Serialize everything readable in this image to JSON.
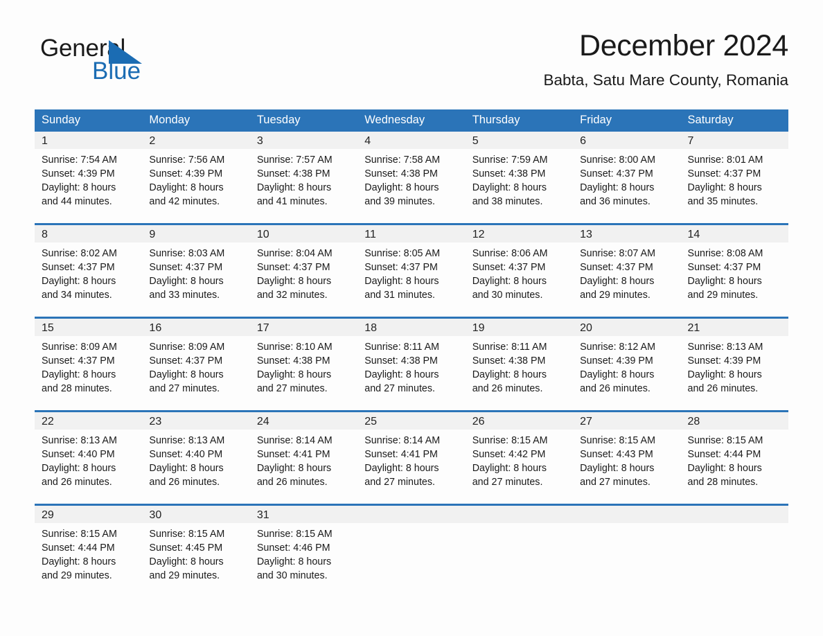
{
  "brand": {
    "name_part1": "General",
    "name_part2": "Blue",
    "accent_color": "#1b6cb3"
  },
  "header": {
    "title": "December 2024",
    "subtitle": "Babta, Satu Mare County, Romania"
  },
  "table": {
    "header_bg": "#2b74b8",
    "daynum_bg": "#f1f1f1",
    "weekdays": [
      "Sunday",
      "Monday",
      "Tuesday",
      "Wednesday",
      "Thursday",
      "Friday",
      "Saturday"
    ]
  },
  "weeks": [
    [
      {
        "day": "1",
        "sunrise": "Sunrise: 7:54 AM",
        "sunset": "Sunset: 4:39 PM",
        "daylight1": "Daylight: 8 hours",
        "daylight2": "and 44 minutes."
      },
      {
        "day": "2",
        "sunrise": "Sunrise: 7:56 AM",
        "sunset": "Sunset: 4:39 PM",
        "daylight1": "Daylight: 8 hours",
        "daylight2": "and 42 minutes."
      },
      {
        "day": "3",
        "sunrise": "Sunrise: 7:57 AM",
        "sunset": "Sunset: 4:38 PM",
        "daylight1": "Daylight: 8 hours",
        "daylight2": "and 41 minutes."
      },
      {
        "day": "4",
        "sunrise": "Sunrise: 7:58 AM",
        "sunset": "Sunset: 4:38 PM",
        "daylight1": "Daylight: 8 hours",
        "daylight2": "and 39 minutes."
      },
      {
        "day": "5",
        "sunrise": "Sunrise: 7:59 AM",
        "sunset": "Sunset: 4:38 PM",
        "daylight1": "Daylight: 8 hours",
        "daylight2": "and 38 minutes."
      },
      {
        "day": "6",
        "sunrise": "Sunrise: 8:00 AM",
        "sunset": "Sunset: 4:37 PM",
        "daylight1": "Daylight: 8 hours",
        "daylight2": "and 36 minutes."
      },
      {
        "day": "7",
        "sunrise": "Sunrise: 8:01 AM",
        "sunset": "Sunset: 4:37 PM",
        "daylight1": "Daylight: 8 hours",
        "daylight2": "and 35 minutes."
      }
    ],
    [
      {
        "day": "8",
        "sunrise": "Sunrise: 8:02 AM",
        "sunset": "Sunset: 4:37 PM",
        "daylight1": "Daylight: 8 hours",
        "daylight2": "and 34 minutes."
      },
      {
        "day": "9",
        "sunrise": "Sunrise: 8:03 AM",
        "sunset": "Sunset: 4:37 PM",
        "daylight1": "Daylight: 8 hours",
        "daylight2": "and 33 minutes."
      },
      {
        "day": "10",
        "sunrise": "Sunrise: 8:04 AM",
        "sunset": "Sunset: 4:37 PM",
        "daylight1": "Daylight: 8 hours",
        "daylight2": "and 32 minutes."
      },
      {
        "day": "11",
        "sunrise": "Sunrise: 8:05 AM",
        "sunset": "Sunset: 4:37 PM",
        "daylight1": "Daylight: 8 hours",
        "daylight2": "and 31 minutes."
      },
      {
        "day": "12",
        "sunrise": "Sunrise: 8:06 AM",
        "sunset": "Sunset: 4:37 PM",
        "daylight1": "Daylight: 8 hours",
        "daylight2": "and 30 minutes."
      },
      {
        "day": "13",
        "sunrise": "Sunrise: 8:07 AM",
        "sunset": "Sunset: 4:37 PM",
        "daylight1": "Daylight: 8 hours",
        "daylight2": "and 29 minutes."
      },
      {
        "day": "14",
        "sunrise": "Sunrise: 8:08 AM",
        "sunset": "Sunset: 4:37 PM",
        "daylight1": "Daylight: 8 hours",
        "daylight2": "and 29 minutes."
      }
    ],
    [
      {
        "day": "15",
        "sunrise": "Sunrise: 8:09 AM",
        "sunset": "Sunset: 4:37 PM",
        "daylight1": "Daylight: 8 hours",
        "daylight2": "and 28 minutes."
      },
      {
        "day": "16",
        "sunrise": "Sunrise: 8:09 AM",
        "sunset": "Sunset: 4:37 PM",
        "daylight1": "Daylight: 8 hours",
        "daylight2": "and 27 minutes."
      },
      {
        "day": "17",
        "sunrise": "Sunrise: 8:10 AM",
        "sunset": "Sunset: 4:38 PM",
        "daylight1": "Daylight: 8 hours",
        "daylight2": "and 27 minutes."
      },
      {
        "day": "18",
        "sunrise": "Sunrise: 8:11 AM",
        "sunset": "Sunset: 4:38 PM",
        "daylight1": "Daylight: 8 hours",
        "daylight2": "and 27 minutes."
      },
      {
        "day": "19",
        "sunrise": "Sunrise: 8:11 AM",
        "sunset": "Sunset: 4:38 PM",
        "daylight1": "Daylight: 8 hours",
        "daylight2": "and 26 minutes."
      },
      {
        "day": "20",
        "sunrise": "Sunrise: 8:12 AM",
        "sunset": "Sunset: 4:39 PM",
        "daylight1": "Daylight: 8 hours",
        "daylight2": "and 26 minutes."
      },
      {
        "day": "21",
        "sunrise": "Sunrise: 8:13 AM",
        "sunset": "Sunset: 4:39 PM",
        "daylight1": "Daylight: 8 hours",
        "daylight2": "and 26 minutes."
      }
    ],
    [
      {
        "day": "22",
        "sunrise": "Sunrise: 8:13 AM",
        "sunset": "Sunset: 4:40 PM",
        "daylight1": "Daylight: 8 hours",
        "daylight2": "and 26 minutes."
      },
      {
        "day": "23",
        "sunrise": "Sunrise: 8:13 AM",
        "sunset": "Sunset: 4:40 PM",
        "daylight1": "Daylight: 8 hours",
        "daylight2": "and 26 minutes."
      },
      {
        "day": "24",
        "sunrise": "Sunrise: 8:14 AM",
        "sunset": "Sunset: 4:41 PM",
        "daylight1": "Daylight: 8 hours",
        "daylight2": "and 26 minutes."
      },
      {
        "day": "25",
        "sunrise": "Sunrise: 8:14 AM",
        "sunset": "Sunset: 4:41 PM",
        "daylight1": "Daylight: 8 hours",
        "daylight2": "and 27 minutes."
      },
      {
        "day": "26",
        "sunrise": "Sunrise: 8:15 AM",
        "sunset": "Sunset: 4:42 PM",
        "daylight1": "Daylight: 8 hours",
        "daylight2": "and 27 minutes."
      },
      {
        "day": "27",
        "sunrise": "Sunrise: 8:15 AM",
        "sunset": "Sunset: 4:43 PM",
        "daylight1": "Daylight: 8 hours",
        "daylight2": "and 27 minutes."
      },
      {
        "day": "28",
        "sunrise": "Sunrise: 8:15 AM",
        "sunset": "Sunset: 4:44 PM",
        "daylight1": "Daylight: 8 hours",
        "daylight2": "and 28 minutes."
      }
    ],
    [
      {
        "day": "29",
        "sunrise": "Sunrise: 8:15 AM",
        "sunset": "Sunset: 4:44 PM",
        "daylight1": "Daylight: 8 hours",
        "daylight2": "and 29 minutes."
      },
      {
        "day": "30",
        "sunrise": "Sunrise: 8:15 AM",
        "sunset": "Sunset: 4:45 PM",
        "daylight1": "Daylight: 8 hours",
        "daylight2": "and 29 minutes."
      },
      {
        "day": "31",
        "sunrise": "Sunrise: 8:15 AM",
        "sunset": "Sunset: 4:46 PM",
        "daylight1": "Daylight: 8 hours",
        "daylight2": "and 30 minutes."
      },
      {
        "day": "",
        "sunrise": "",
        "sunset": "",
        "daylight1": "",
        "daylight2": ""
      },
      {
        "day": "",
        "sunrise": "",
        "sunset": "",
        "daylight1": "",
        "daylight2": ""
      },
      {
        "day": "",
        "sunrise": "",
        "sunset": "",
        "daylight1": "",
        "daylight2": ""
      },
      {
        "day": "",
        "sunrise": "",
        "sunset": "",
        "daylight1": "",
        "daylight2": ""
      }
    ]
  ]
}
